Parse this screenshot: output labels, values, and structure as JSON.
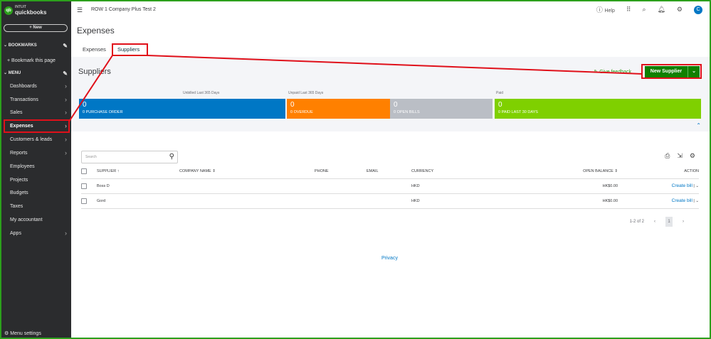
{
  "sidebar": {
    "brand_top": "INTUIT",
    "brand": "quickbooks",
    "new": "+ New",
    "bookmarks": "BOOKMARKS",
    "bookmark_page": "+ Bookmark this page",
    "menu": "MENU",
    "items": [
      {
        "label": "Dashboards"
      },
      {
        "label": "Transactions"
      },
      {
        "label": "Sales"
      },
      {
        "label": "Expenses"
      },
      {
        "label": "Customers & leads"
      },
      {
        "label": "Reports"
      },
      {
        "label": "Employees"
      },
      {
        "label": "Projects"
      },
      {
        "label": "Budgets"
      },
      {
        "label": "Taxes"
      },
      {
        "label": "My accountant"
      },
      {
        "label": "Apps"
      }
    ],
    "menu_settings": "Menu settings"
  },
  "header": {
    "company": "ROW 1 Company Plus Test 2",
    "help": "Help",
    "avatar": "C"
  },
  "page": {
    "title": "Expenses",
    "tabs": [
      {
        "label": "Expenses"
      },
      {
        "label": "Suppliers"
      }
    ]
  },
  "suppliers": {
    "title": "Suppliers",
    "feedback": "Give feedback",
    "new_supplier": "New Supplier",
    "labels": {
      "unbilled": "Unbilled Last 365 Days",
      "unpaid": "Unpaid Last 365 Days",
      "paid": "Paid"
    },
    "cards": [
      {
        "value": "0",
        "sub": "0  PURCHASE ORDER",
        "color": "#0077c5"
      },
      {
        "value": "0",
        "sub": "0  OVERDUE",
        "color": "#ff8000"
      },
      {
        "value": "0",
        "sub": "0  OPEN BILLS",
        "color": "#babec5"
      },
      {
        "value": "0",
        "sub": "0  PAID LAST 30 DAYS",
        "color": "#7fd000"
      }
    ]
  },
  "table": {
    "search_placeholder": "Search",
    "headers": {
      "supplier": "SUPPLIER ↑",
      "company": "COMPANY NAME ⇕",
      "phone": "PHONE",
      "email": "EMAIL",
      "currency": "CURRENCY",
      "balance": "OPEN BALANCE ⇕",
      "action": "ACTION"
    },
    "rows": [
      {
        "supplier": "Boss D",
        "company": "",
        "phone": "",
        "email": "",
        "currency": "HKD",
        "balance": "HK$0.00",
        "action": "Create bill"
      },
      {
        "supplier": "Gord",
        "company": "",
        "phone": "",
        "email": "",
        "currency": "HKD",
        "balance": "HK$0.00",
        "action": "Create bill"
      }
    ],
    "pagination": {
      "range": "1-2 of 2",
      "prev": "‹",
      "page": "1",
      "next": "›"
    }
  },
  "footer": {
    "privacy": "Privacy"
  }
}
